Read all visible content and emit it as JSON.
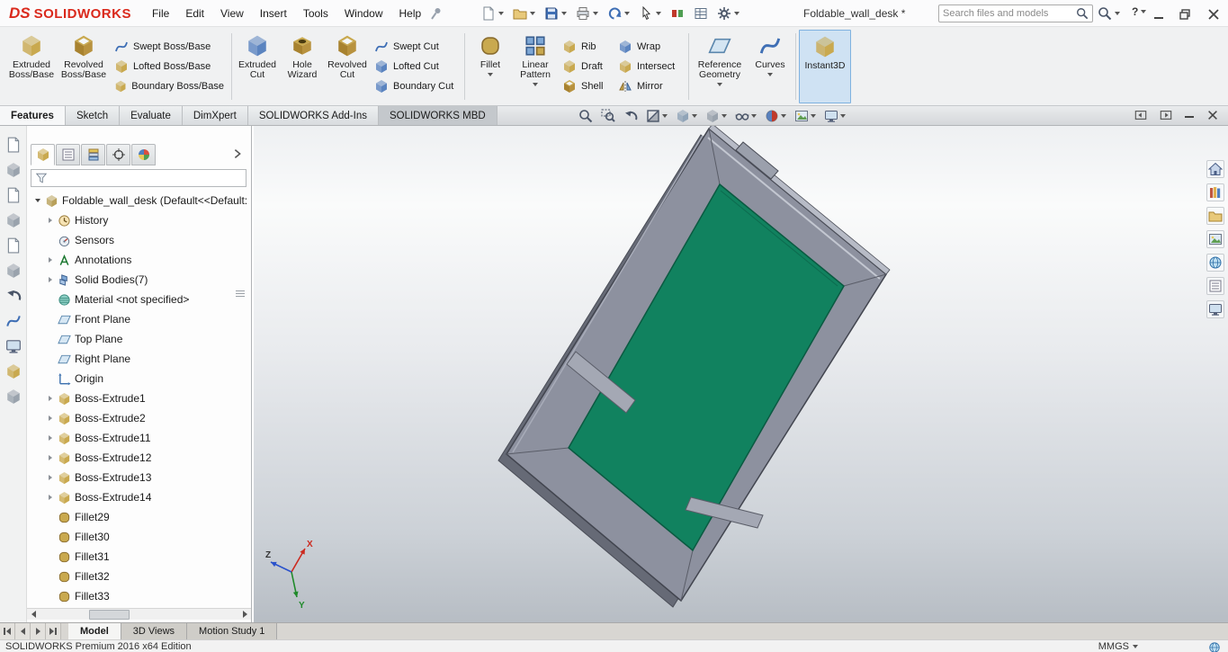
{
  "titlebar": {
    "logo_mark": "DS",
    "logo_text": "SOLIDWORKS",
    "menus": [
      "File",
      "Edit",
      "View",
      "Insert",
      "Tools",
      "Window",
      "Help"
    ],
    "document_title": "Foldable_wall_desk *",
    "search_placeholder": "Search files and models",
    "help": "?"
  },
  "ribbon": {
    "extruded_boss": "Extruded Boss/Base",
    "revolved_boss": "Revolved Boss/Base",
    "swept_boss": "Swept Boss/Base",
    "lofted_boss": "Lofted Boss/Base",
    "boundary_boss": "Boundary Boss/Base",
    "extruded_cut": "Extruded Cut",
    "hole_wizard": "Hole Wizard",
    "revolved_cut": "Revolved Cut",
    "swept_cut": "Swept Cut",
    "lofted_cut": "Lofted Cut",
    "boundary_cut": "Boundary Cut",
    "fillet": "Fillet",
    "linear_pattern": "Linear Pattern",
    "rib": "Rib",
    "draft": "Draft",
    "shell": "Shell",
    "wrap": "Wrap",
    "intersect": "Intersect",
    "mirror": "Mirror",
    "reference_geometry": "Reference Geometry",
    "curves": "Curves",
    "instant3d": "Instant3D"
  },
  "command_tabs": [
    "Features",
    "Sketch",
    "Evaluate",
    "DimXpert",
    "SOLIDWORKS Add-Ins",
    "SOLIDWORKS MBD"
  ],
  "feature_tree": {
    "root": "Foldable_wall_desk  (Default<<Default:",
    "items": [
      "History",
      "Sensors",
      "Annotations",
      "Solid Bodies(7)",
      "Material <not specified>",
      "Front Plane",
      "Top Plane",
      "Right Plane",
      "Origin",
      "Boss-Extrude1",
      "Boss-Extrude2",
      "Boss-Extrude11",
      "Boss-Extrude12",
      "Boss-Extrude13",
      "Boss-Extrude14",
      "Fillet29",
      "Fillet30",
      "Fillet31",
      "Fillet32",
      "Fillet33"
    ]
  },
  "triad": {
    "x": "X",
    "y": "Y",
    "z": "Z"
  },
  "bottom_tabs": [
    "Model",
    "3D Views",
    "Motion Study 1"
  ],
  "statusbar": {
    "edition": "SOLIDWORKS Premium 2016 x64 Edition",
    "units": "MMGS"
  },
  "colors": {
    "desk_frame": "#8d919f",
    "desk_panel_green": "#11825f",
    "selection_blue": "#cfe2f3",
    "logo_red": "#da291c"
  }
}
